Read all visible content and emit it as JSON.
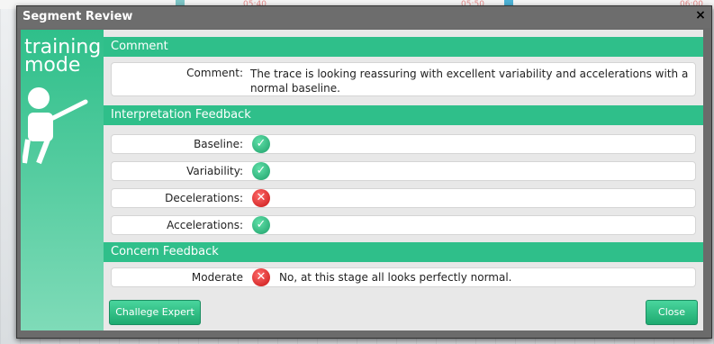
{
  "background": {
    "times": [
      "05:40",
      "05:50",
      "06:00"
    ]
  },
  "dialog": {
    "title": "Segment Review",
    "close_glyph": "×",
    "side": {
      "mode_line1": "training",
      "mode_line2": "mode"
    },
    "sections": {
      "comment": "Comment",
      "interpretation": "Interpretation Feedback",
      "concern": "Concern Feedback"
    },
    "comment_row": {
      "label": "Comment:",
      "text": "The trace is looking reassuring with excellent variability and accelerations with a normal baseline."
    },
    "interpretation": [
      {
        "label": "Baseline:",
        "status": "correct",
        "icon": "check-circle-icon"
      },
      {
        "label": "Variability:",
        "status": "correct",
        "icon": "check-circle-icon"
      },
      {
        "label": "Decelerations:",
        "status": "incorrect",
        "icon": "x-circle-icon"
      },
      {
        "label": "Accelerations:",
        "status": "correct",
        "icon": "check-circle-icon"
      }
    ],
    "concern_row": {
      "label": "Moderate",
      "status": "incorrect",
      "text": "No, at this stage all looks perfectly normal."
    },
    "buttons": {
      "challenge": "Challege Expert",
      "close": "Close"
    },
    "colors": {
      "accent": "#2fbf8a",
      "correct": "#1f9f6a",
      "incorrect": "#c81414"
    }
  }
}
